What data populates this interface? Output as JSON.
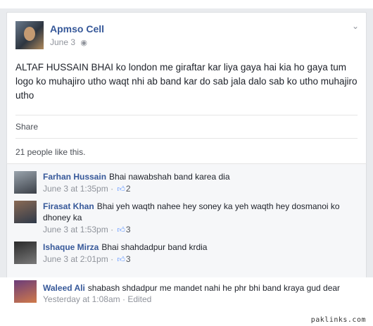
{
  "post": {
    "author": "Apmso Cell",
    "date": "June 3",
    "globe_icon": "globe-icon",
    "text": "ALTAF HUSSAIN BHAI ko london me giraftar kar liya gaya hai kia ho gaya tum logo ko muhajiro utho waqt nhi ab band kar do sab jala dalo sab ko utho muhajiro utho",
    "share_label": "Share",
    "likes_summary": "21 people like this."
  },
  "comments": [
    {
      "name": "Farhan Hussain",
      "text": "Bhai nawabshah band karea dia",
      "time": "June 3 at 1:35pm",
      "likes": "2"
    },
    {
      "name": "Firasat Khan",
      "text": "Bhai yeh waqth nahee hey soney ka yeh waqth hey dosmanoi ko dhoney ka",
      "time": "June 3 at 1:53pm",
      "likes": "3"
    },
    {
      "name": "Ishaque Mirza",
      "text": "Bhai shahdadpur band krdia",
      "time": "June 3 at 2:01pm",
      "likes": "3"
    },
    {
      "name": "Waleed Ali",
      "text": "shabash shdadpur me mandet nahi he phr bhi band kraya gud dear",
      "time": "Yesterday at 1:08am",
      "edited": "Edited"
    }
  ],
  "watermark": "paklinks.com",
  "colors": {
    "name_link": "#365899",
    "meta": "#90949c",
    "like_blue": "#5890ff"
  }
}
